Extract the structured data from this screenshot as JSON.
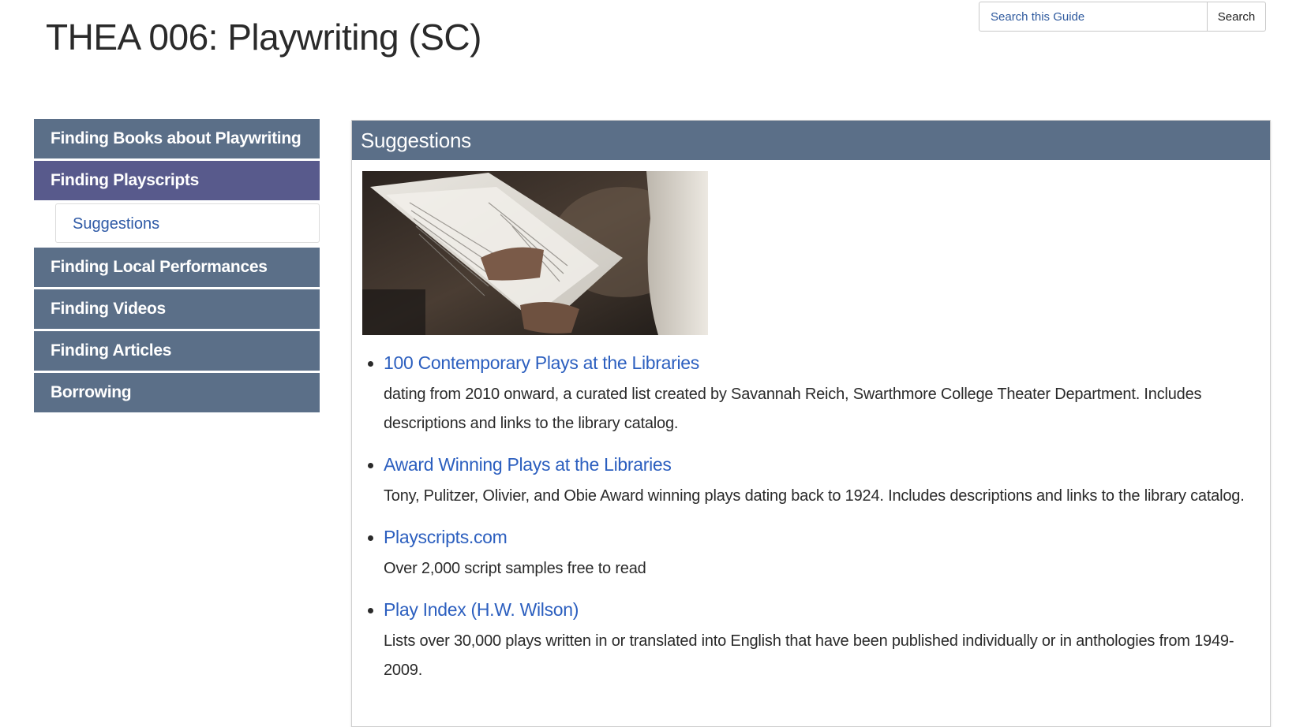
{
  "header": {
    "title": "THEA 006: Playwriting (SC)"
  },
  "search": {
    "placeholder": "Search this Guide",
    "button_label": "Search"
  },
  "sidebar": {
    "items": [
      {
        "label": "Finding Books about Playwriting",
        "active": false
      },
      {
        "label": "Finding Playscripts",
        "active": true
      },
      {
        "label": "Finding Local Performances",
        "active": false
      },
      {
        "label": "Finding Videos",
        "active": false
      },
      {
        "label": "Finding Articles",
        "active": false
      },
      {
        "label": "Borrowing",
        "active": false
      }
    ],
    "subitem": {
      "label": "Suggestions"
    }
  },
  "panel": {
    "title": "Suggestions",
    "resources": [
      {
        "link": "100 Contemporary Plays at the Libraries",
        "description": "dating from 2010 onward, a curated list created by Savannah Reich, Swarthmore College Theater Department. Includes descriptions and links to the library catalog."
      },
      {
        "link": "Award Winning Plays at the Libraries",
        "description": "Tony, Pulitzer, Olivier, and Obie Award winning plays dating back to 1924. Includes descriptions and links to the library catalog."
      },
      {
        "link": "Playscripts.com",
        "description": "Over 2,000 script samples free to read"
      },
      {
        "link": "Play Index (H.W. Wilson)",
        "description": "Lists over 30,000 plays written in or translated into English that have been published individually or in anthologies from 1949-2009."
      }
    ]
  },
  "colors": {
    "nav_bg": "#5b6f88",
    "nav_active_bg": "#585a8c",
    "link": "#2c5fbf"
  }
}
